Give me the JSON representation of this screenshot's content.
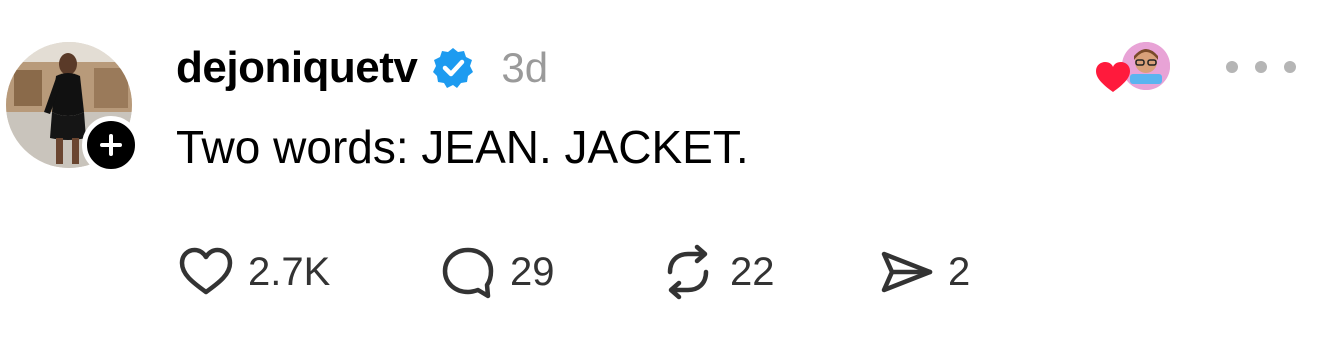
{
  "post": {
    "author": {
      "username": "dejoniquetv",
      "verified": true
    },
    "timestamp": "3d",
    "text": "Two words: JEAN. JACKET.",
    "stats": {
      "likes": "2.7K",
      "replies": "29",
      "reposts": "22",
      "shares": "2"
    }
  },
  "icons": {
    "avatar": "profile-photo",
    "follow": "plus-icon",
    "verified": "verified-badge-icon",
    "liked_by": "heart-icon",
    "more": "more-dots-icon",
    "like": "heart-outline-icon",
    "reply": "comment-bubble-icon",
    "repost": "repost-arrows-icon",
    "share": "send-icon"
  },
  "colors": {
    "verified_blue": "#1d9bf0",
    "heart_red": "#ff1a3c",
    "muted_gray": "#9a9a9a",
    "icon_dark": "#333333"
  }
}
